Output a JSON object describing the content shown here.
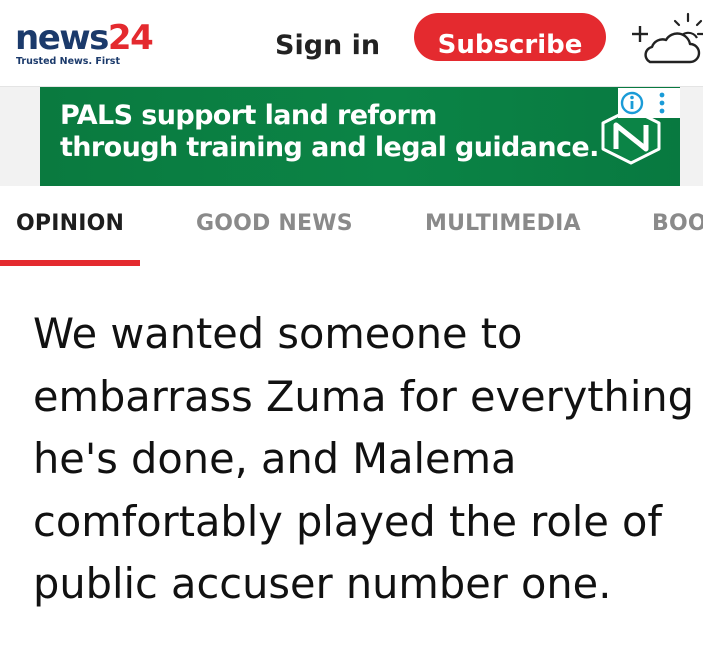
{
  "header": {
    "logo": {
      "word": "news",
      "number": "24",
      "tagline": "Trusted News. First"
    },
    "signin_label": "Sign in",
    "subscribe_label": "Subscribe",
    "weather_icon": "add-weather-icon"
  },
  "ad": {
    "line1": "PALS support land reform",
    "line2": "through training and legal guidance.",
    "brand_icon": "nedbank-logo-icon",
    "choices_icons": [
      "info-icon",
      "more-options-icon"
    ]
  },
  "tabs": [
    {
      "label": "OPINION",
      "active": true
    },
    {
      "label": "GOOD NEWS",
      "active": false
    },
    {
      "label": "MULTIMEDIA",
      "active": false
    },
    {
      "label": "BOO",
      "active": false
    }
  ],
  "article": {
    "quote_lines": [
      "We wanted someone to",
      "embarrass Zuma for everything",
      "he's done, and Malema",
      "comfortably played the role of",
      "public accuser number one."
    ]
  },
  "colors": {
    "brand_navy": "#1b3a6b",
    "brand_red": "#e42a2f",
    "ad_green": "#0b8446",
    "choices_blue": "#1a9bd7"
  }
}
